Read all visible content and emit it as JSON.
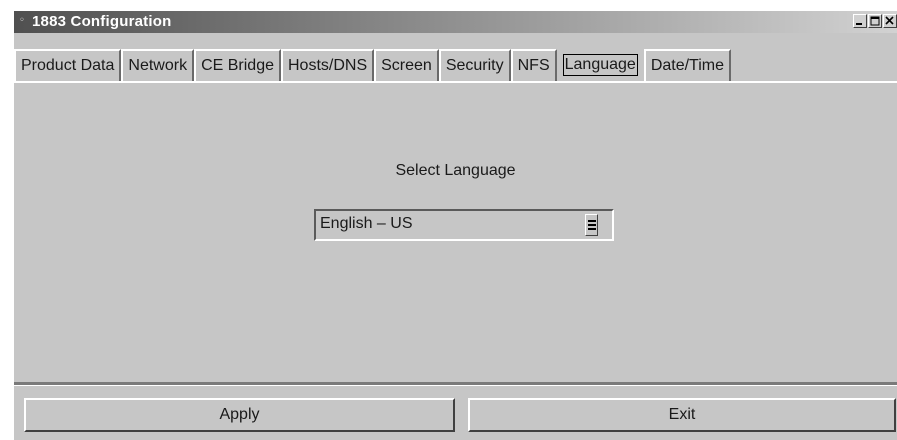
{
  "window": {
    "title": "1883 Configuration",
    "icon": "app-icon"
  },
  "tabs": [
    {
      "label": "Product Data",
      "selected": false
    },
    {
      "label": "Network",
      "selected": false
    },
    {
      "label": "CE Bridge",
      "selected": false
    },
    {
      "label": "Hosts/DNS",
      "selected": false
    },
    {
      "label": "Screen",
      "selected": false
    },
    {
      "label": "Security",
      "selected": false
    },
    {
      "label": "NFS",
      "selected": false
    },
    {
      "label": "Language",
      "selected": true
    },
    {
      "label": "Date/Time",
      "selected": false
    }
  ],
  "language": {
    "prompt": "Select Language",
    "selected_value": "English – US"
  },
  "buttons": {
    "apply": "Apply",
    "exit": "Exit"
  },
  "colors": {
    "panel": "#c6c6c6",
    "title_start": "#505050",
    "title_end": "#d2d2d2"
  }
}
